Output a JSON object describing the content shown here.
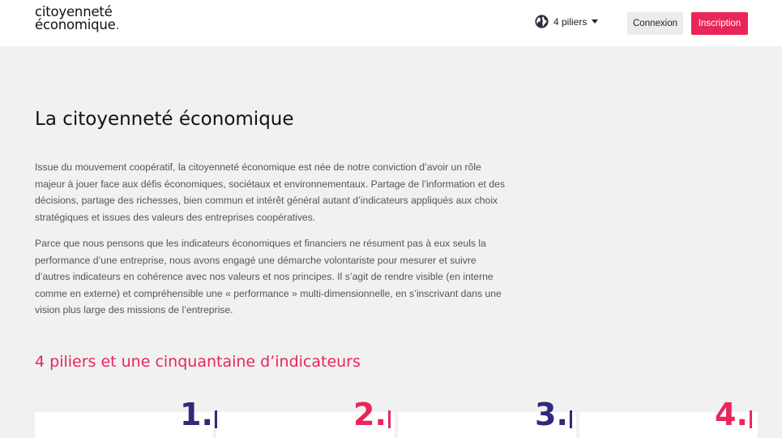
{
  "header": {
    "logo_line1": "citoyenneté",
    "logo_line2": "économique",
    "logo_dot": ".",
    "menu_label": "4 piliers",
    "login_label": "Connexion",
    "signup_label": "Inscription"
  },
  "main": {
    "title": "La citoyenneté économique",
    "paragraph1": "Issue du mouvement coopératif, la citoyenneté économique est née de notre conviction d’avoir un rôle majeur à jouer face aux défis économiques, sociétaux et environnementaux. Partage de l’information et des décisions, partage des richesses, bien commun et intérêt général autant d’indicateurs appliqués aux choix stratégiques et issues des valeurs des entreprises coopératives.",
    "paragraph2": "Parce que nous pensons que les indicateurs économiques et financiers ne résument pas à eux seuls la performance d’une entreprise, nous avons engagé une démarche volontariste pour mesurer et suivre d’autres indicateurs en cohérence avec nos valeurs et nos principes. Il s’agit de rendre visible (en interne comme en externe) et compréhensible une « performance » multi-dimensionnelle, en s’inscrivant dans une vision plus large des missions de l’entreprise.",
    "section_title": "4 piliers et une cinquantaine d’indicateurs"
  },
  "pillars": [
    {
      "number": "1.",
      "color": "#2f2a7a"
    },
    {
      "number": "2.",
      "color": "#e8265a"
    },
    {
      "number": "3.",
      "color": "#2f2a7a"
    },
    {
      "number": "4.",
      "color": "#e8265a"
    }
  ],
  "colors": {
    "accent": "#e8265a",
    "navy": "#2f2a7a",
    "background": "#f1f1f1"
  },
  "icons": {
    "menu": "globe-icon",
    "dropdown": "caret-down-icon"
  }
}
